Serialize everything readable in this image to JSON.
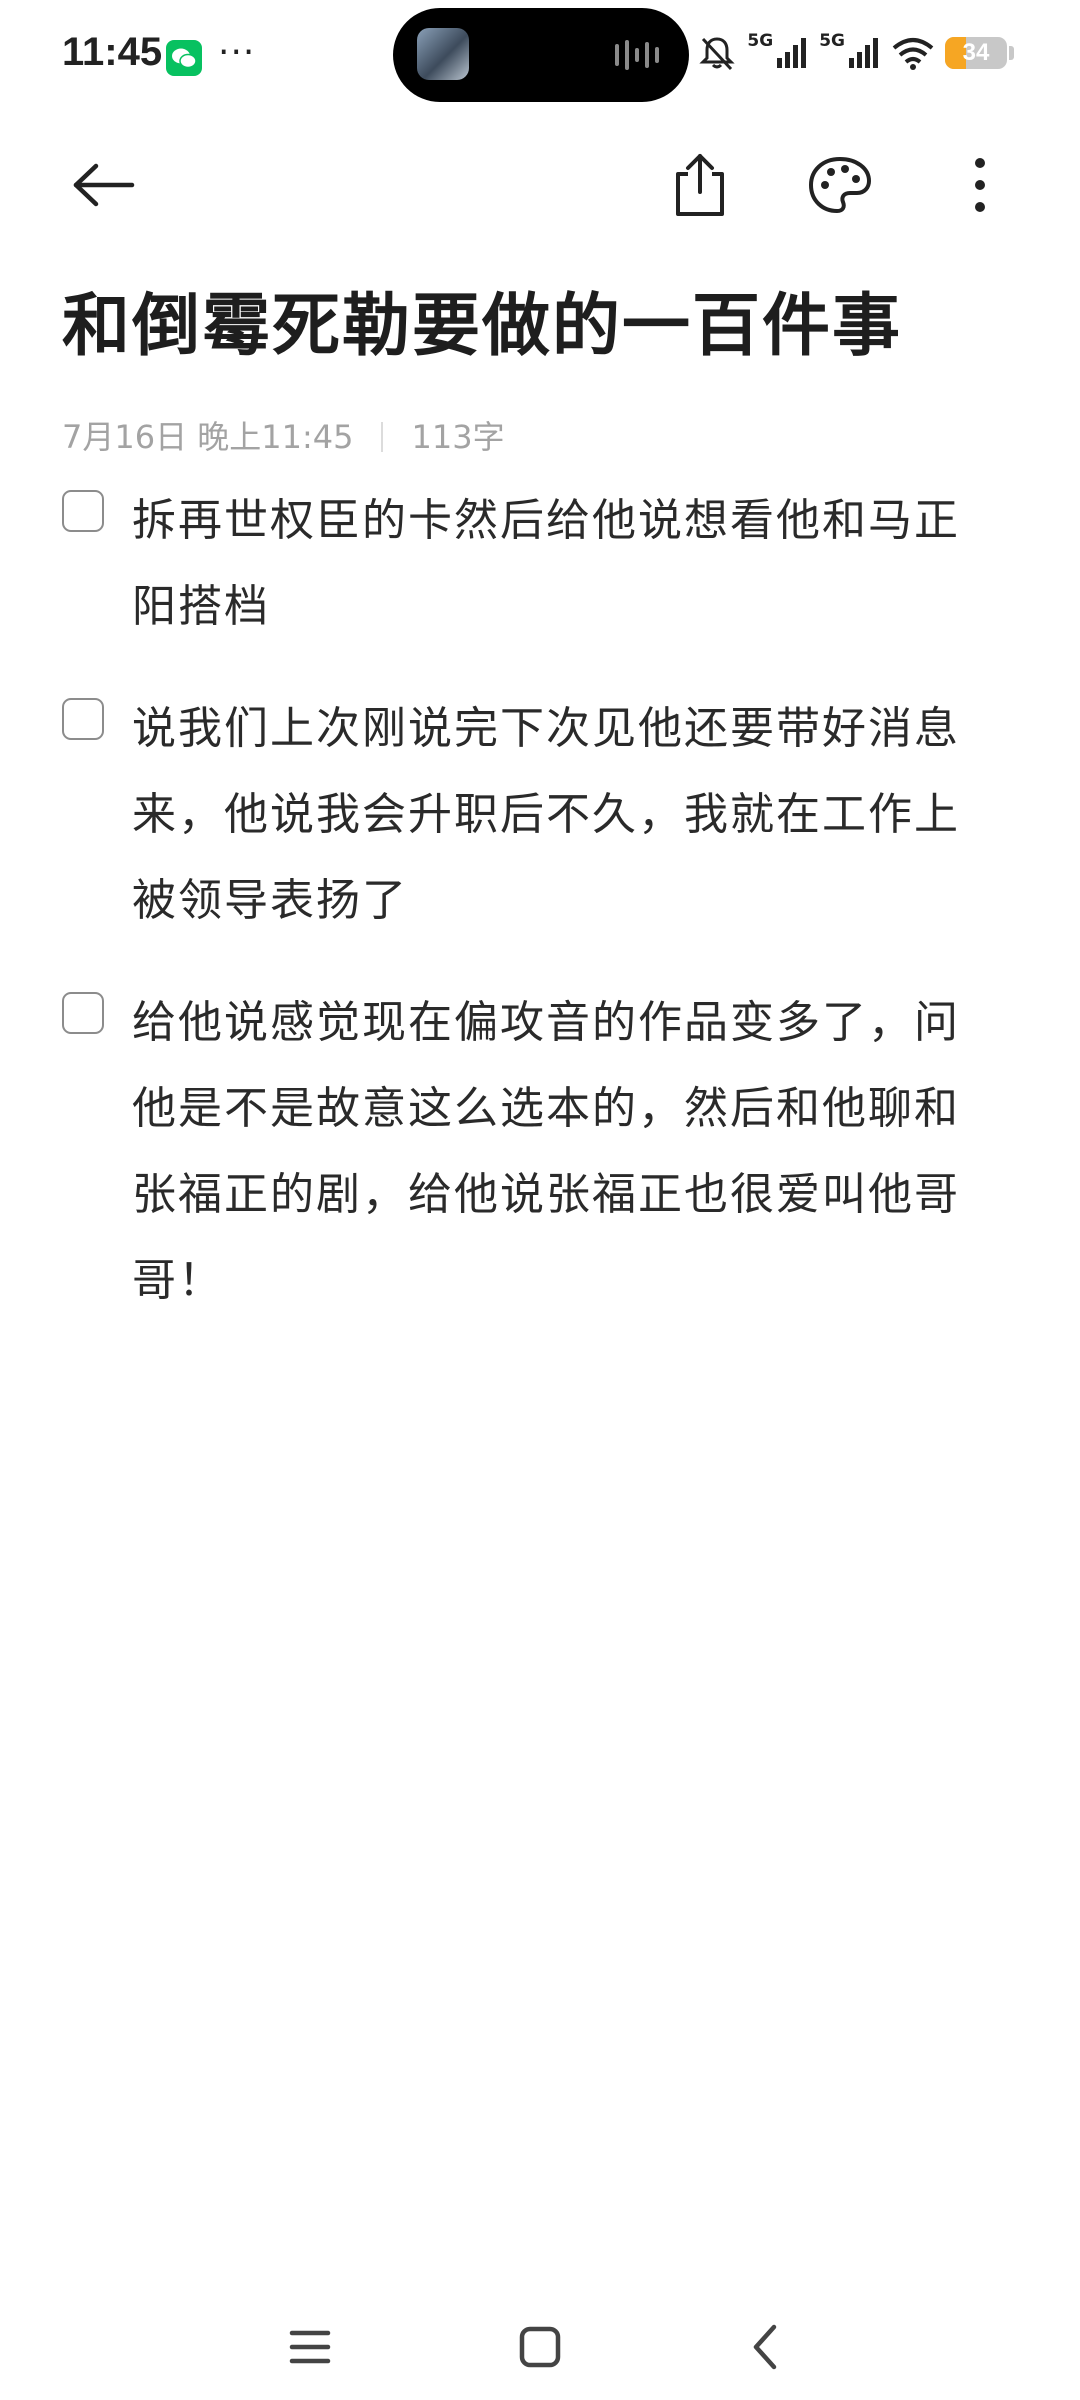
{
  "status_bar": {
    "time": "11:45",
    "more": "···",
    "network_1": "5G",
    "network_2": "5G",
    "battery_level": "34",
    "battery_fraction": 0.34,
    "battery_color": "#f6a623",
    "icons": [
      "wechat-icon",
      "mute-bell-icon",
      "signal-icon",
      "wifi-icon",
      "battery-icon"
    ]
  },
  "toolbar": {
    "icons": [
      "back-arrow-icon",
      "share-icon",
      "palette-icon",
      "more-vertical-icon"
    ]
  },
  "note": {
    "title": "和倒霉死勒要做的一百件事",
    "date": "7月16日 晚上11:45",
    "word_count": "113字",
    "items": [
      {
        "checked": false,
        "text": "拆再世权臣的卡然后给他说想看他和马正阳搭档"
      },
      {
        "checked": false,
        "text": "说我们上次刚说完下次见他还要带好消息来，他说我会升职后不久，我就在工作上被领导表扬了"
      },
      {
        "checked": false,
        "text": "给他说感觉现在偏攻音的作品变多了，问他是不是故意这么选本的，然后和他聊和张福正的剧，给他说张福正也很爱叫他哥哥！"
      }
    ]
  },
  "nav_bar": {
    "icons": [
      "menu-icon",
      "home-square-icon",
      "back-chevron-icon"
    ]
  }
}
